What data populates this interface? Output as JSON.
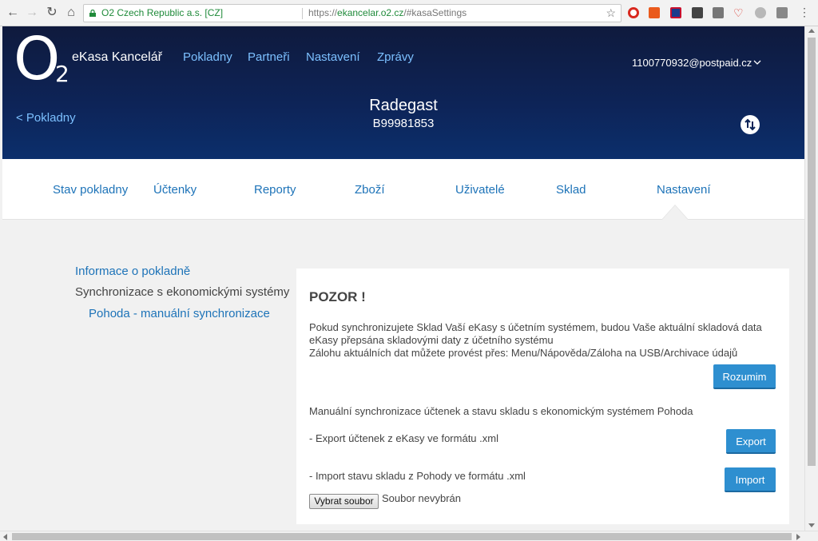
{
  "browser": {
    "secure_label": "O2 Czech Republic a.s. [CZ]",
    "url_scheme": "https://",
    "url_host": "ekancelar.o2.cz",
    "url_path": "/#kasaSettings"
  },
  "header": {
    "logo_letter": "O",
    "logo_subscript": "2",
    "brand": "eKasa Kancelář",
    "nav": [
      "Pokladny",
      "Partneři",
      "Nastavení",
      "Zprávy"
    ],
    "account": "1100770932@postpaid.cz",
    "back_link": "< Pokladny",
    "store_name": "Radegast",
    "store_id": "B99981853"
  },
  "tabs": [
    "Stav pokladny",
    "Účtenky",
    "Reporty",
    "Zboží",
    "Uživatelé",
    "Sklad",
    "Nastavení"
  ],
  "active_tab": "Nastavení",
  "sidemenu": {
    "info": "Informace o pokladně",
    "sync": "Synchronizace s ekonomickými systémy",
    "pohoda": "Pohoda - manuální synchronizace"
  },
  "panel": {
    "title": "POZOR !",
    "warning_line1": "Pokud synchronizujete Sklad Vaší eKasy s účetním systémem, budou Vaše aktuální skladová data",
    "warning_line2": "eKasy přepsána skladovými daty z účetního systému",
    "warning_line3": "Zálohu aktuálních dat můžete provést přes: Menu/Nápověda/Záloha na USB/Archivace údajů",
    "understand_button": "Rozumim",
    "manual_sync_text": "Manuální synchronizace účtenek a stavu skladu s ekonomickým systémem Pohoda",
    "export_text": "- Export účtenek z eKasy ve formátu .xml",
    "export_button": "Export",
    "import_text": "- Import stavu skladu z Pohody ve formátu .xml",
    "import_button": "Import",
    "file_button": "Vybrat soubor",
    "file_status": "Soubor nevybrán"
  },
  "colors": {
    "link": "#1d73b8",
    "header_link": "#7cc0ff",
    "button": "#2e8fd0",
    "hero_top": "#0f1a3d",
    "hero_bottom": "#0c2f6c"
  }
}
